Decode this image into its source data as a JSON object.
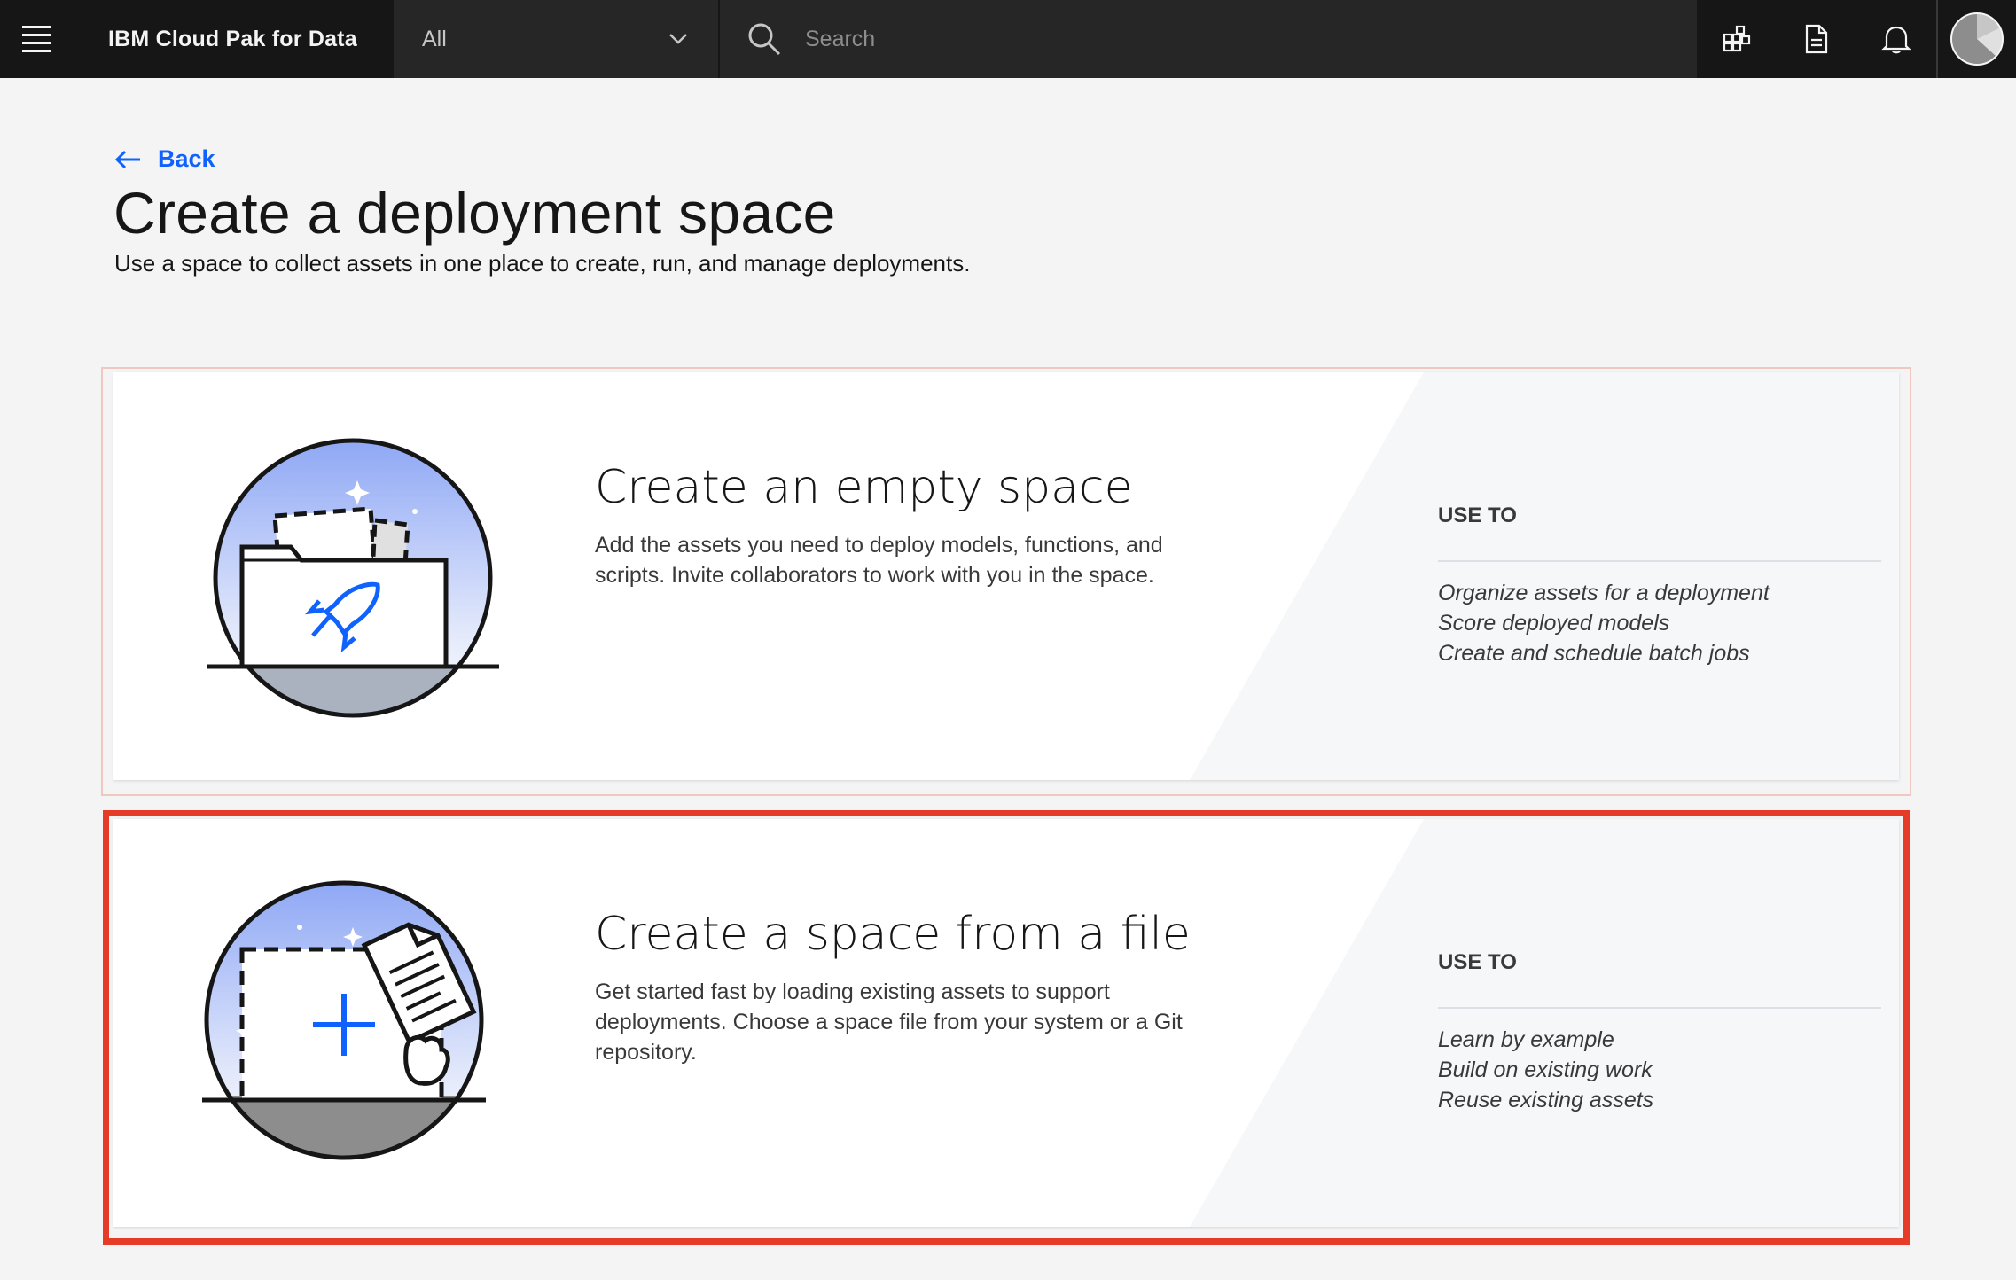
{
  "header": {
    "brand": "IBM Cloud Pak for Data",
    "scope_selected": "All",
    "search_placeholder": "Search",
    "icons": [
      "apps-switcher-icon",
      "document-icon",
      "notification-bell-icon",
      "user-avatar"
    ]
  },
  "page": {
    "back_label": "Back",
    "title": "Create a deployment space",
    "subtitle": "Use a space to collect assets in one place to create, run, and manage deployments."
  },
  "cards": [
    {
      "title": "Create an empty space",
      "description": "Add the assets you need to deploy models, functions, and scripts. Invite collaborators to work with you in the space.",
      "use_to_label": "USE TO",
      "use_to": [
        "Organize assets for a deployment",
        "Score deployed models",
        "Create and schedule batch jobs"
      ]
    },
    {
      "title": "Create a space from a file",
      "description": "Get started fast by loading existing assets to support deployments. Choose a space file from your system or a Git repository.",
      "use_to_label": "USE TO",
      "use_to": [
        "Learn by example",
        "Build on existing work",
        "Reuse existing assets"
      ]
    }
  ],
  "colors": {
    "header_bg": "#262626",
    "link_blue": "#0f62fe",
    "highlight_red": "#e63b26",
    "page_bg": "#f4f4f4"
  }
}
